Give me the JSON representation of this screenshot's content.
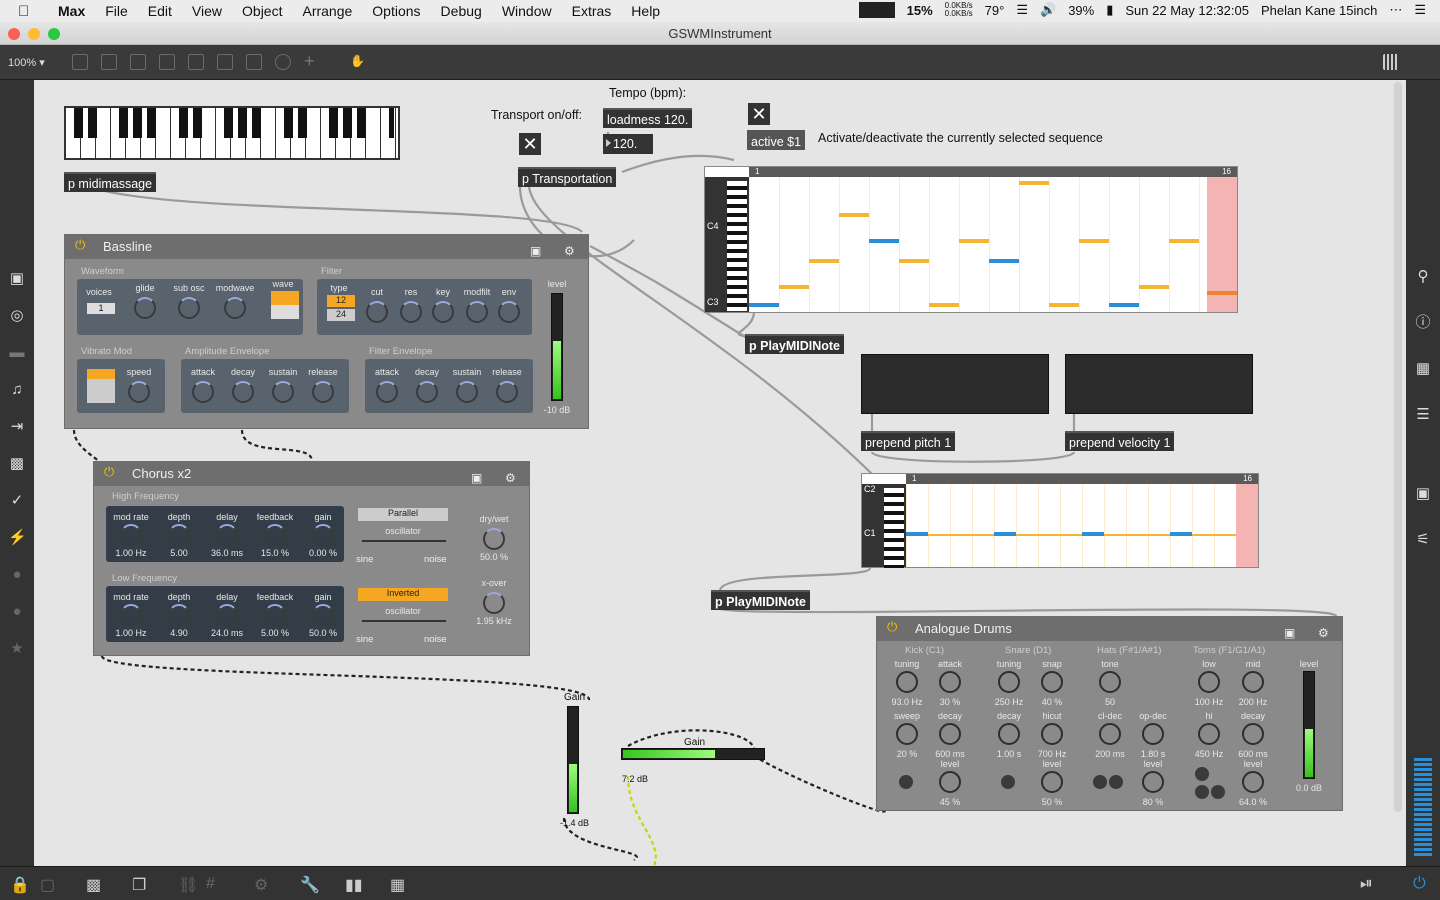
{
  "menubar": {
    "app": "Max",
    "items": [
      "File",
      "Edit",
      "View",
      "Object",
      "Arrange",
      "Options",
      "Debug",
      "Window",
      "Extras",
      "Help"
    ],
    "status": {
      "cpu": "15%",
      "net_up": "0.0KB/s",
      "net_down": "0.0KB/s",
      "temp": "79°",
      "battery": "39%",
      "clock": "Sun 22 May  12:32:05",
      "user": "Phelan Kane 15inch"
    }
  },
  "window": {
    "title": "GSWMInstrument",
    "zoom": "100%"
  },
  "patch": {
    "kslider_comment": "",
    "midimassage": "p midimassage",
    "transport_label": "Transport on/off:",
    "tempo_label": "Tempo (bpm):",
    "loadmess": "loadmess 120.",
    "tempo_value": "120.",
    "transportation": "p Transportation",
    "active_msg": "active $1",
    "active_comment": "Activate/deactivate the currently selected sequence",
    "playmidinote1": "p PlayMIDINote",
    "prepend_pitch": "prepend pitch 1",
    "prepend_velocity": "prepend velocity 1",
    "playmidinote2": "p PlayMIDINote",
    "seq1": {
      "start": "1",
      "end": "16",
      "c4": "C4",
      "c3": "C3"
    },
    "seq2": {
      "start": "1",
      "end": "16",
      "c2": "C2",
      "c1": "C1"
    },
    "gain1": {
      "label": "Gain",
      "value": "-1.4 dB"
    },
    "gain2": {
      "label": "Gain",
      "value": "7.2 dB"
    }
  },
  "bassline": {
    "title": "Bassline",
    "waveform": "Waveform",
    "filter": "Filter",
    "vibrato": "Vibrato Mod",
    "amp_env": "Amplitude Envelope",
    "filter_env": "Filter Envelope",
    "voices_label": "voices",
    "voices_value": "1",
    "knobs1": [
      "glide",
      "sub osc",
      "modwave"
    ],
    "wave": "wave",
    "type": "type",
    "type_a": "12",
    "type_b": "24",
    "knobs2": [
      "cut",
      "res",
      "key",
      "modfilt",
      "env"
    ],
    "speed": "speed",
    "amp": [
      "attack",
      "decay",
      "sustain",
      "release"
    ],
    "fenv": [
      "attack",
      "decay",
      "sustain",
      "release"
    ],
    "level": "level",
    "level_value": "-10 dB"
  },
  "chorus": {
    "title": "Chorus x2",
    "hf": "High Frequency",
    "lf": "Low Frequency",
    "labels": [
      "mod rate",
      "depth",
      "delay",
      "feedback",
      "gain"
    ],
    "hf_values": [
      "1.00 Hz",
      "5.00",
      "36.0 ms",
      "15.0 %",
      "0.00 %"
    ],
    "lf_values": [
      "1.00 Hz",
      "4.90",
      "24.0 ms",
      "5.00 %",
      "50.0 %"
    ],
    "parallel": "Parallel",
    "inverted": "Inverted",
    "oscillator": "oscillator",
    "sine": "sine",
    "noise": "noise",
    "drywet": "dry/wet",
    "drywet_value": "50.0 %",
    "xover": "x-over",
    "xover_value": "1.95 kHz"
  },
  "drums": {
    "title": "Analogue Drums",
    "kick": "Kick (C1)",
    "snare": "Snare (D1)",
    "hats": "Hats (F#1/A#1)",
    "toms": "Toms (F1/G1/A1)",
    "kick_row1": [
      [
        "tuning",
        "93.0 Hz"
      ],
      [
        "attack",
        "30 %"
      ]
    ],
    "kick_row2": [
      [
        "sweep",
        "20 %"
      ],
      [
        "decay",
        "600 ms"
      ]
    ],
    "kick_level": [
      "level",
      "45 %"
    ],
    "snare_row1": [
      [
        "tuning",
        "250 Hz"
      ],
      [
        "snap",
        "40 %"
      ]
    ],
    "snare_row2": [
      [
        "decay",
        "1.00 s"
      ],
      [
        "hicut",
        "700 Hz"
      ]
    ],
    "snare_level": [
      "level",
      "50 %"
    ],
    "hats_row1": [
      [
        "tone",
        "50"
      ]
    ],
    "hats_row2": [
      [
        "cl-dec",
        "200 ms"
      ],
      [
        "op-dec",
        "1.80 s"
      ]
    ],
    "hats_level": [
      "level",
      "80 %"
    ],
    "toms_row1": [
      [
        "low",
        "100 Hz"
      ],
      [
        "mid",
        "200 Hz"
      ]
    ],
    "toms_row2": [
      [
        "hi",
        "450 Hz"
      ],
      [
        "decay",
        "600 ms"
      ]
    ],
    "toms_level": [
      "level",
      "64.0 %"
    ],
    "level": "level",
    "level_value": "0.0 dB"
  },
  "colors": {
    "accent": "#f5a623",
    "seq_note": "#f5b533",
    "seq_note_blue": "#2a8fd6",
    "meter": "#35c21e",
    "power": "#f5c400"
  }
}
